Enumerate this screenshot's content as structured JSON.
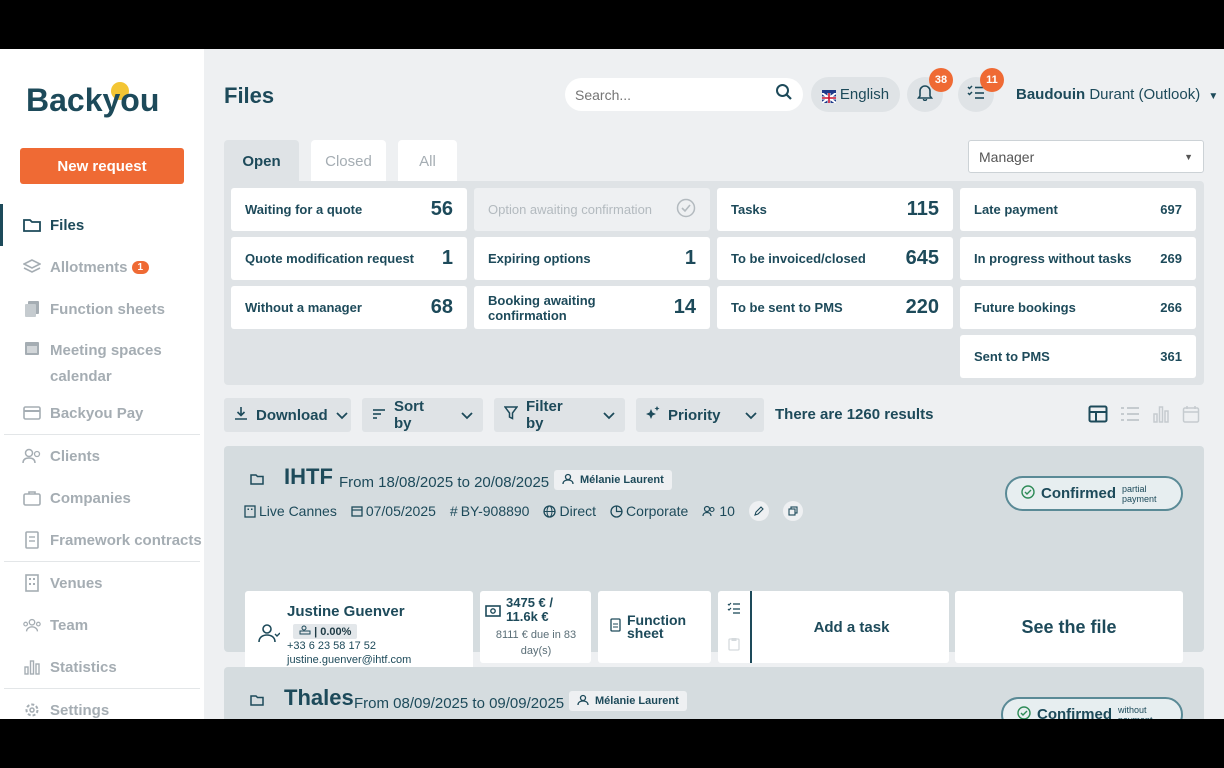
{
  "app": {
    "name": "Backyou"
  },
  "sidebar": {
    "new_request": "New request",
    "items": [
      {
        "label": "Files"
      },
      {
        "label": "Allotments",
        "badge": "1"
      },
      {
        "label": "Function sheets"
      },
      {
        "label": "Meeting spaces calendar"
      },
      {
        "label": "Backyou Pay"
      },
      {
        "label": "Clients"
      },
      {
        "label": "Companies"
      },
      {
        "label": "Framework contracts"
      },
      {
        "label": "Venues"
      },
      {
        "label": "Team"
      },
      {
        "label": "Statistics"
      },
      {
        "label": "Settings"
      }
    ]
  },
  "header": {
    "title": "Files",
    "search_placeholder": "Search...",
    "language": "English",
    "notifications_count": "38",
    "tasks_count": "11",
    "user_first": "Baudouin",
    "user_rest": "Durant (Outlook)"
  },
  "tabs": [
    "Open",
    "Closed",
    "All"
  ],
  "manager_select": "Manager",
  "stats": [
    {
      "label": "Waiting for a quote",
      "value": "56"
    },
    {
      "label": "Option awaiting confirmation",
      "value": ""
    },
    {
      "label": "Tasks",
      "value": "115"
    },
    {
      "label": "Late payment",
      "value": "697"
    },
    {
      "label": "Quote modification request",
      "value": "1"
    },
    {
      "label": "Expiring options",
      "value": "1"
    },
    {
      "label": "To be invoiced/closed",
      "value": "645"
    },
    {
      "label": "In progress without tasks",
      "value": "269"
    },
    {
      "label": "Without a manager",
      "value": "68"
    },
    {
      "label": "Booking awaiting confirmation",
      "value": "14"
    },
    {
      "label": "To be sent to PMS",
      "value": "220"
    },
    {
      "label": "Future bookings",
      "value": "266"
    },
    {
      "label": "Sent to PMS",
      "value": "361"
    }
  ],
  "toolbar": {
    "download": "Download",
    "sort": "Sort by",
    "filter": "Filter by",
    "priority": "Priority",
    "results": "There are 1260 results"
  },
  "files": [
    {
      "name": "IHTF",
      "dates": "From 18/08/2025 to 20/08/2025",
      "manager": "Mélanie Laurent",
      "status": "Confirmed",
      "status_note": "partial payment",
      "venue": "Live Cannes",
      "date": "07/05/2025",
      "ref": "BY-908890",
      "channel": "Direct",
      "segment": "Corporate",
      "guests": "10",
      "contact_name": "Justine Guenver",
      "contact_rate": "| 0.00%",
      "contact_phone": "+33 6 23 58 17 52",
      "contact_email": "justine.guenver@ihtf.com",
      "amount": "3475 € / 11.6k €",
      "amount_due": "8111 € due in 83 day(s)",
      "function_sheet": "Function sheet",
      "add_task": "Add a task",
      "see_file": "See the file"
    },
    {
      "name": "Thales",
      "dates": "From 08/09/2025 to 09/09/2025",
      "manager": "Mélanie Laurent",
      "status": "Confirmed",
      "status_note": "without payment"
    }
  ]
}
